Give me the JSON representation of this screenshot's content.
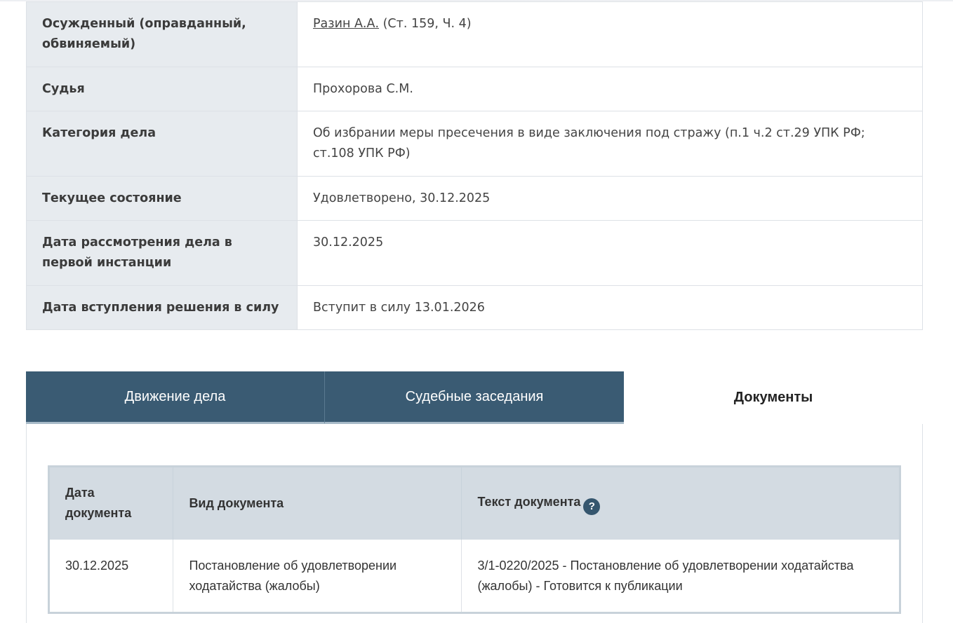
{
  "case_info": {
    "rows": [
      {
        "label": "Осужденный (оправданный, обвиняемый)",
        "person_link": "Разин А.А.",
        "person_extra": " (Ст. 159, Ч. 4)"
      },
      {
        "label": "Судья",
        "value": "Прохорова С.М."
      },
      {
        "label": "Категория дела",
        "value": "Об избрании меры пресечения в виде заключения под стражу (п.1 ч.2 ст.29 УПК РФ; ст.108 УПК РФ)"
      },
      {
        "label": "Текущее состояние",
        "value": "Удовлетворено, 30.12.2025"
      },
      {
        "label": "Дата рассмотрения дела в первой инстанции",
        "value": "30.12.2025"
      },
      {
        "label": "Дата вступления решения в силу",
        "value": "Вступит в силу 13.01.2026"
      }
    ]
  },
  "tabs": [
    {
      "label": "Движение дела",
      "active": false
    },
    {
      "label": "Судебные заседания",
      "active": false
    },
    {
      "label": "Документы",
      "active": true
    }
  ],
  "documents": {
    "columns": [
      "Дата документа",
      "Вид документа",
      "Текст документа"
    ],
    "help_icon": "?",
    "rows": [
      {
        "date": "30.12.2025",
        "type": "Постановление об удовлетворении ходатайства (жалобы)",
        "text": "3/1-0220/2025 - Постановление об удовлетворении ходатайства (жалобы) - Готовится к публикации"
      }
    ]
  },
  "colors": {
    "tab_inactive": "#3a5b73",
    "label_bg": "#e7ebef",
    "table_header_bg": "#d3dbe2"
  }
}
